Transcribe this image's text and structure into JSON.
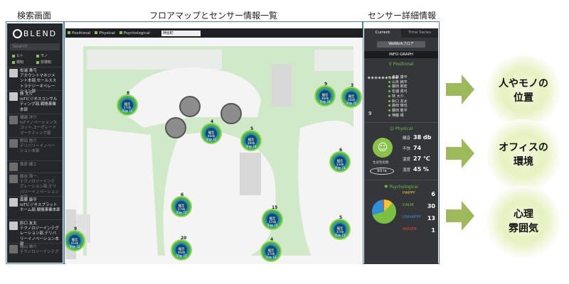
{
  "captions": {
    "search": "検索画面",
    "floormap": "フロアマップとセンサー情報一覧",
    "detail": "センサー詳細情報"
  },
  "sidebar": {
    "logo": "BLEND",
    "search_placeholder": "Search",
    "filters": [
      "ヒト",
      "モノ",
      "検知",
      "非検知"
    ],
    "people": [
      {
        "text": "松浦 貴弓\nアカウントマネジメ\nント本部,セールスス\nトラテジーオペレー\nション部"
      },
      {
        "text": "林 大介\nIoTビジネスコンサル\nティング部,戦略事業\n本部"
      },
      {
        "text": "樋越 洋介\nIoTイノベーションス\nコット,コーポレート\nマーケティング部"
      },
      {
        "text": "野田 悠介\nデリバリーイノベー\nション本部"
      },
      {
        "text": "桑原 健二"
      },
      {
        "text": "飯谷 周一\nテクノロジーインテ\nグレーション部,デリ\nバリーイノベーション本部"
      },
      {
        "text": "森藤 康平\nIoTビジネスプラット\nホーム部,戦略事業本部"
      },
      {
        "text": "鈴口 友太\nテクノロジーインテグ\nレーション部,デリバ\nリーイノベーション本部"
      },
      {
        "text": "橋山 雄介\nテクノロジーインテグ"
      }
    ]
  },
  "topbar": {
    "checks": [
      "Positional",
      "Physical",
      "Psychological"
    ],
    "select": "神谷町"
  },
  "sensors": [
    {
      "count": "8",
      "l1": "騒音 37db",
      "l2": "不快 72"
    },
    {
      "count": "4",
      "l1": "騒音 46db",
      "l2": "不快 72"
    },
    {
      "count": "5",
      "l1": "騒音 38db",
      "l2": "不快 74"
    },
    {
      "count": "9",
      "l1": "騒音 36db",
      "l2": "不快 70"
    },
    {
      "count": "3",
      "l1": "騒音 34db",
      "l2": "不快 72"
    },
    {
      "count": "6",
      "l1": "騒音 33db",
      "l2": "不快 73"
    },
    {
      "count": "6",
      "l1": "騒音 37db",
      "l2": "不快 72"
    },
    {
      "count": "15",
      "l1": "騒音 37db",
      "l2": "不快 72"
    },
    {
      "count": "5",
      "l1": "騒音 37db",
      "l2": "不快 73"
    },
    {
      "count": "9",
      "l1": "騒音 41db",
      "l2": "不快 72"
    },
    {
      "count": "20",
      "l1": "騒音 36db",
      "l2": "不快 72"
    },
    {
      "count": "4",
      "l1": "騒音 37db",
      "l2": "不快 72"
    }
  ],
  "detail": {
    "tab_current": "Current",
    "tab_series": "Time Series",
    "place": "WeWorkフロア",
    "info_graph": "INFO GRAPH",
    "positional_label": "Positional",
    "people_count": "9",
    "people": [
      "森藤 康平",
      "山本 純平",
      "藤田 和宏",
      "松浦 貴弓",
      "林 大介",
      "鈴口 友太",
      "森田 琢也",
      "藤田 敬平",
      "神藤 晴"
    ],
    "physical_label": "Physical",
    "sensing_label": "生産性指数",
    "lux": "93 lx",
    "metrics": [
      {
        "k": "騒音",
        "v": "38 db"
      },
      {
        "k": "不快",
        "v": "74"
      },
      {
        "k": "温度",
        "v": "27 ℃"
      },
      {
        "k": "湿度",
        "v": "45 %"
      }
    ],
    "psychological_label": "Psychological",
    "emotions": [
      {
        "k": "HAPPY",
        "v": "6",
        "c": "#f4c430"
      },
      {
        "k": "CALM",
        "v": "30",
        "c": "#7ac043"
      },
      {
        "k": "UNHAPPY",
        "v": "13",
        "c": "#2f8fd8"
      },
      {
        "k": "ANGER",
        "v": "1",
        "c": "#e04848"
      }
    ]
  },
  "bulbs": [
    {
      "l1": "人やモノの",
      "l2": "位置"
    },
    {
      "l1": "オフィスの",
      "l2": "環境"
    },
    {
      "l1": "心理",
      "l2": "雰囲気"
    }
  ],
  "colors": {
    "floor_green": "#bfe8b8",
    "ring_green": "#3fb54a",
    "accent": "#7ac043"
  }
}
